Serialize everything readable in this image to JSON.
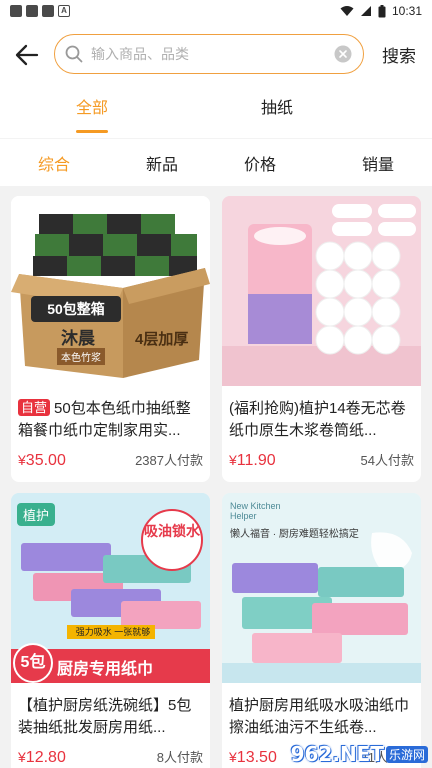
{
  "status_bar": {
    "time": "10:31"
  },
  "header": {
    "search_placeholder": "输入商品、品类",
    "search_button": "搜索"
  },
  "tabs": [
    {
      "label": "全部",
      "active": true
    },
    {
      "label": "抽纸",
      "active": false
    }
  ],
  "sort_options": [
    {
      "label": "综合",
      "active": true
    },
    {
      "label": "新品",
      "active": false
    },
    {
      "label": "价格",
      "active": false
    },
    {
      "label": "销量",
      "active": false
    }
  ],
  "products": [
    {
      "badge": "自营",
      "title": "50包本色纸巾抽纸整箱餐巾纸巾定制家用实...",
      "price_symbol": "¥",
      "price": "35.00",
      "sold": "2387人付款",
      "image_text": {
        "box": "50包整箱",
        "brand": "沐晨",
        "sub": "本色竹浆",
        "side": "4层加厚"
      }
    },
    {
      "badge": "",
      "title": "(福利抢购)植护14卷无芯卷纸巾原生木浆卷筒纸...",
      "price_symbol": "¥",
      "price": "11.90",
      "sold": "54人付款",
      "image_text": {}
    },
    {
      "badge": "",
      "title": "【植护厨房纸洗碗纸】5包装抽纸批发厨房用纸...",
      "price_symbol": "¥",
      "price": "12.80",
      "sold": "8人付款",
      "image_text": {
        "brand": "植护",
        "oil": "吸油锁水",
        "count": "5包",
        "banner": "厨房专用纸巾",
        "strip": "强力吸水 一张就够"
      }
    },
    {
      "badge": "",
      "title": "植护厨房用纸吸水吸油纸巾擦油纸油污不生纸卷...",
      "price_symbol": "¥",
      "price": "13.50",
      "sold": "11人付款",
      "image_text": {
        "en": "New Kitchen Helper",
        "cn": "懒人福音 · 厨房难题轻松搞定"
      }
    }
  ],
  "watermark": {
    "text": "962.NET",
    "sub": "乐游网"
  },
  "colors": {
    "accent": "#f59a23",
    "price": "#e8323e",
    "search_border": "#f0a040"
  }
}
